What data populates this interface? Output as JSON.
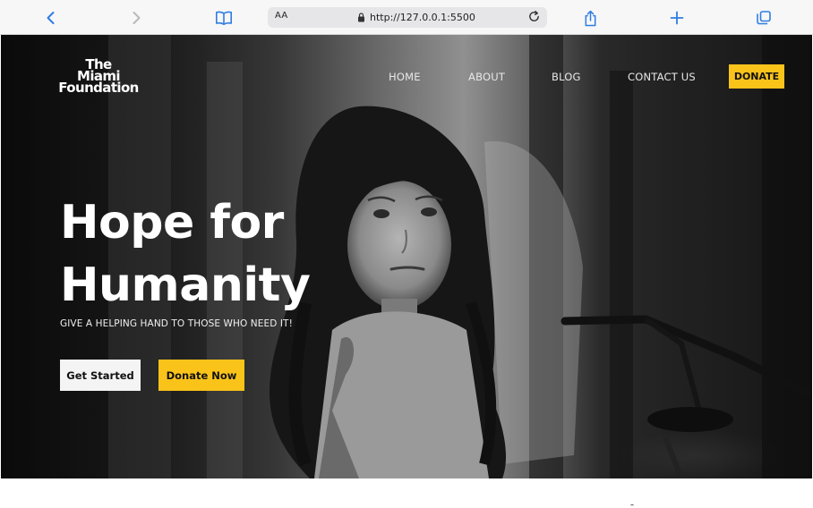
{
  "browser": {
    "reader_label": "AA",
    "url": "http://127.0.0.1:5500"
  },
  "site": {
    "logo_lines": [
      "The",
      "Miami",
      "Foundation"
    ],
    "nav": {
      "home": "HOME",
      "about": "ABOUT",
      "blog": "BLOG",
      "contact": "CONTACT US",
      "donate": "DONATE"
    },
    "hero": {
      "title_lines": [
        "Hope for",
        "Humanity"
      ],
      "subtitle": "GIVE A HELPING HAND TO THOSE WHO NEED IT!",
      "get_started": "Get Started",
      "donate_now": "Donate Now"
    }
  },
  "colors": {
    "accent": "#f9c31a",
    "browser_icon": "#2f7de1",
    "hero_text": "#ffffff"
  },
  "icons": [
    "chevron-left-icon",
    "chevron-right-icon",
    "book-icon",
    "lock-icon",
    "reload-icon",
    "share-icon",
    "plus-icon",
    "tabs-icon"
  ]
}
